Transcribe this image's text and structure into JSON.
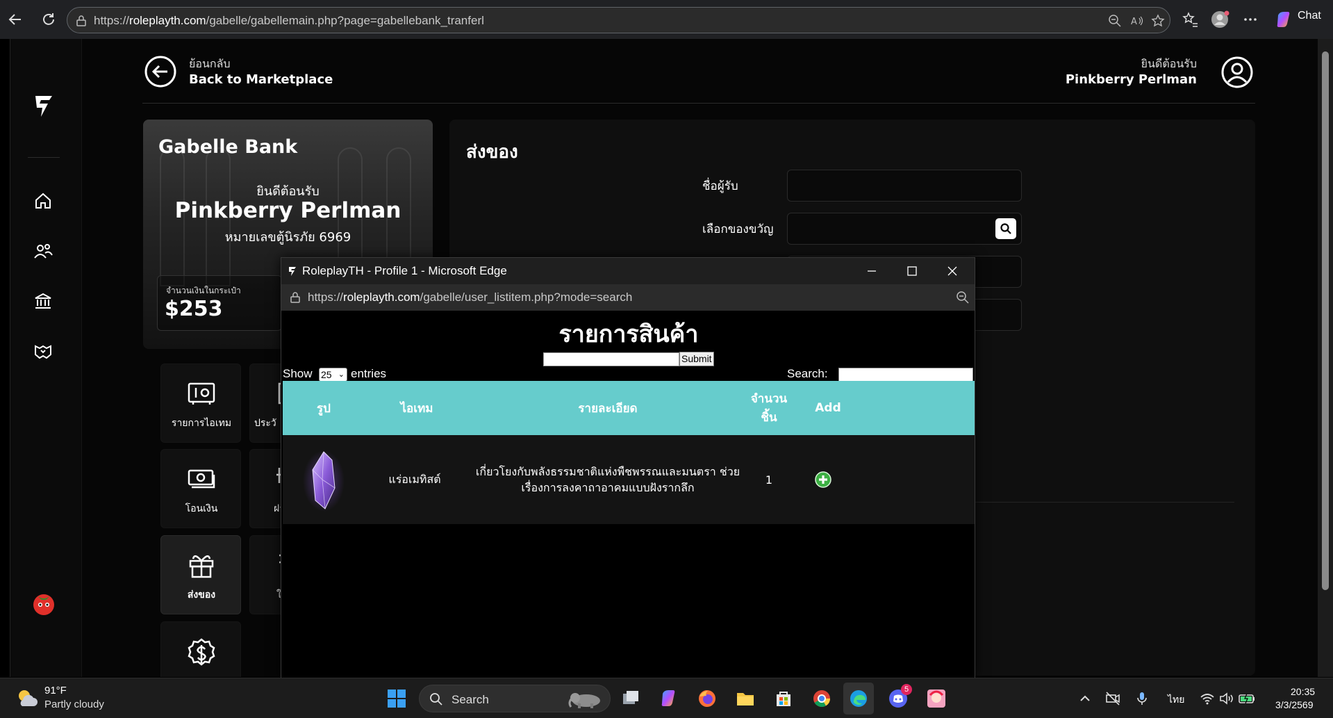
{
  "browser": {
    "url_prefix": "https://",
    "url_host": "roleplayth.com",
    "url_path": "/gabelle/gabellemain.php?page=gabellebank_tranferl",
    "chat_label": "Chat"
  },
  "header": {
    "back_small": "ย้อนกลับ",
    "back_big": "Back to Marketplace",
    "welcome_small": "ยินดีต้อนรับ",
    "welcome_name": "Pinkberry Perlman"
  },
  "bank_card": {
    "title": "Gabelle Bank",
    "welcome": "ยินดีต้อนรับ",
    "name": "Pinkberry Perlman",
    "account": "หมายเลขตู้นิรภัย 6969",
    "wallet_label": "จำนวนเงินในกระเป๋า",
    "wallet_value": "$253"
  },
  "tiles": [
    {
      "label": "รายการไอเทม",
      "icon": "safe-icon"
    },
    {
      "label": "ประวั",
      "icon": "history-icon"
    },
    {
      "label": "โอนเงิน",
      "icon": "money-transfer-icon"
    },
    {
      "label": "ฝา",
      "icon": "deposit-icon"
    },
    {
      "label": "ส่งของ",
      "icon": "gift-icon"
    },
    {
      "label": "ใ",
      "icon": "puzzle-icon"
    },
    {
      "label": "",
      "icon": "dollar-badge-icon"
    }
  ],
  "form": {
    "title": "ส่งของ",
    "recipient_label": "ชื่อผู้รับ",
    "gift_label": "เลือกของขวัญ"
  },
  "popup": {
    "window_title": "RoleplayTH - Profile 1 - Microsoft Edge",
    "url_prefix": "https://",
    "url_host": "roleplayth.com",
    "url_path": "/gabelle/user_listitem.php?mode=search",
    "heading": "รายการสินค้า",
    "submit_label": "Submit",
    "show_label": "Show",
    "show_value": "25",
    "entries_label": "entries",
    "search_label": "Search:",
    "columns": [
      "รูป",
      "ไอเทม",
      "รายละเอียด",
      "จำนวน ชิ้น",
      "Add"
    ],
    "rows": [
      {
        "item": "แร่อเมทิสต์",
        "detail": "เกี่ยวโยงกับพลังธรรมชาติแห่งพืชพรรณและมนตรา ช่วยเรื่องการลงคาถาอาคมแบบฝังรากลึก",
        "qty": "1"
      }
    ]
  },
  "taskbar": {
    "temp": "91°F",
    "weather": "Partly cloudy",
    "search_label": "Search",
    "discord_badge": "5",
    "lang": "ไทย",
    "time": "20:35",
    "date": "3/3/2569"
  }
}
